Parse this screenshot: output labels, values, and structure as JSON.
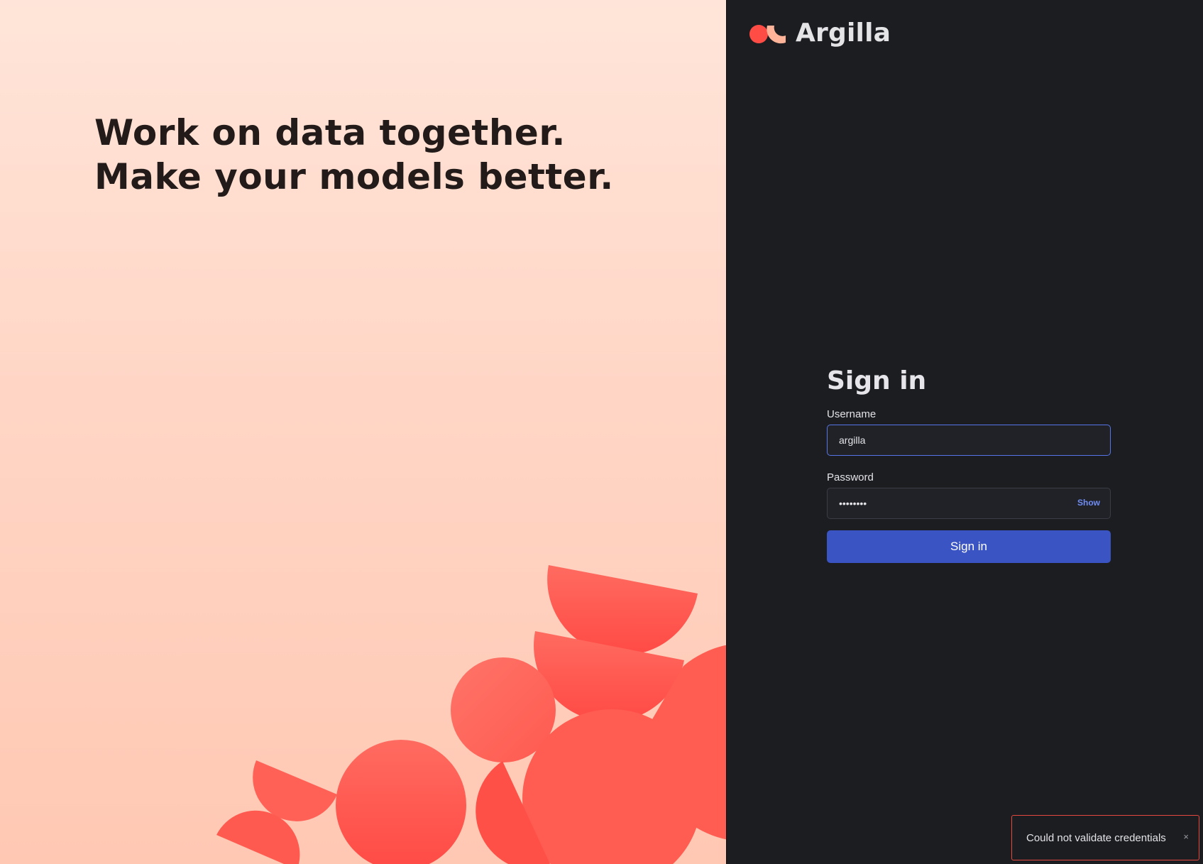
{
  "hero": {
    "line1": "Work on data together.",
    "line2": "Make your models better."
  },
  "brand": {
    "name": "Argilla",
    "logo_icon": "argilla-logo-icon"
  },
  "signin": {
    "title": "Sign in",
    "username_label": "Username",
    "username_value": "argilla",
    "password_label": "Password",
    "password_value": "••••••••",
    "show_label": "Show",
    "submit_label": "Sign in"
  },
  "toast": {
    "message": "Could not validate credentials",
    "close_glyph": "×"
  },
  "colors": {
    "accent": "#3a54c4",
    "shape": "#ff5a4f",
    "focus_border": "#5676e8",
    "error_border": "#e5483f"
  }
}
